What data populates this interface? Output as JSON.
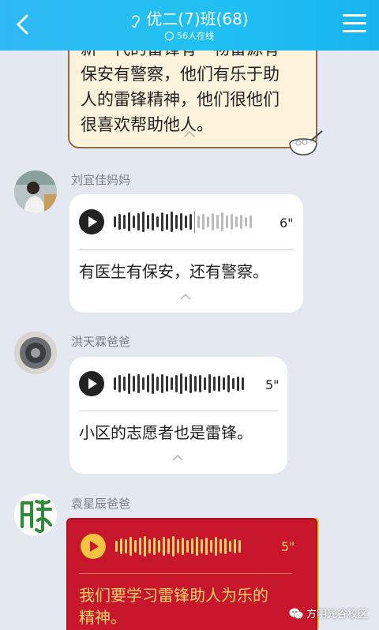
{
  "header": {
    "title": "优二(7)班(68)",
    "online": "56人在线"
  },
  "messages": [
    {
      "text_lines": [
        "新一代的雷锋有一物雷源有",
        "保安有警察，他们有乐于助",
        "人的雷锋精神，他们很他们",
        "很喜欢帮助他人。"
      ]
    },
    {
      "sender": "刘宜佳妈妈",
      "duration": "6\"",
      "text": "有医生有保安，还有警察。"
    },
    {
      "sender": "洪天霖爸爸",
      "duration": "5\"",
      "text": "小区的志愿者也是雷锋。"
    },
    {
      "sender": "袁星辰爸爸",
      "duration": "5\"",
      "text_lines": [
        "我们要学习雷锋助人为乐的",
        "精神。"
      ]
    }
  ],
  "watermark": "方明光谷校区",
  "colors": {
    "header": "#22c1f2",
    "background": "#e4e8f1",
    "red_bubble": "#c8172c",
    "gold": "#f8d36a"
  },
  "icons": [
    "back-arrow-icon",
    "ear-icon",
    "online-icon",
    "menu-icon",
    "play-icon",
    "chevron-up-icon",
    "bowl-sticker",
    "wechat-icon"
  ]
}
